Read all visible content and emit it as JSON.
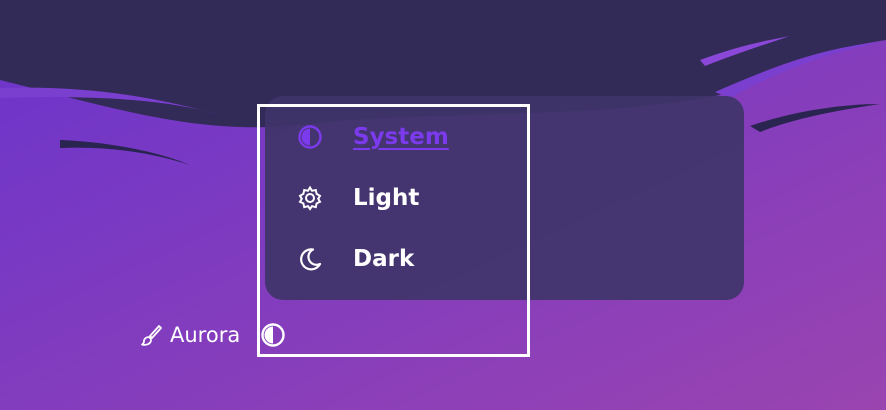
{
  "theme_menu": {
    "items": [
      {
        "label": "System",
        "icon": "half-circle-icon",
        "selected": true
      },
      {
        "label": "Light",
        "icon": "gear-icon",
        "selected": false
      },
      {
        "label": "Dark",
        "icon": "moon-icon",
        "selected": false
      }
    ]
  },
  "footer": {
    "brand_label": "Aurora",
    "brand_icon": "paintbrush-icon",
    "toggle_icon": "half-circle-icon"
  },
  "colors": {
    "background": "#6f37c6",
    "menu_background": "#3f3469",
    "selected_accent": "#7c3aed",
    "text": "#ffffff"
  }
}
